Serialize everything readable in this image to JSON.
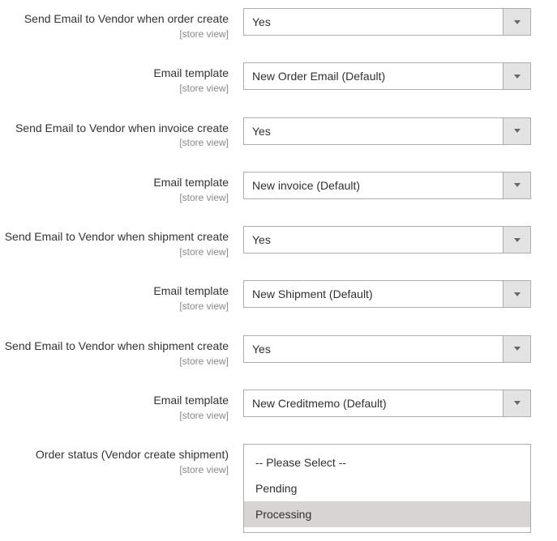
{
  "scope_label": "[store view]",
  "fields": {
    "order_email": {
      "label": "Send Email to Vendor when order create",
      "value": "Yes"
    },
    "order_email_template": {
      "label": "Email template",
      "value": "New Order Email (Default)"
    },
    "invoice_email": {
      "label": "Send Email to Vendor when invoice create",
      "value": "Yes"
    },
    "invoice_email_template": {
      "label": "Email template",
      "value": "New invoice (Default)"
    },
    "shipment_email": {
      "label": "Send Email to Vendor when shipment create",
      "value": "Yes"
    },
    "shipment_email_template": {
      "label": "Email template",
      "value": "New Shipment (Default)"
    },
    "creditmemo_email": {
      "label": "Send Email to Vendor when shipment create",
      "value": "Yes"
    },
    "creditmemo_email_template": {
      "label": "Email template",
      "value": "New Creditmemo (Default)"
    },
    "order_status": {
      "label": "Order status (Vendor create shipment)",
      "options": [
        "-- Please Select --",
        "Pending",
        "Processing"
      ],
      "selected": "Processing"
    }
  }
}
